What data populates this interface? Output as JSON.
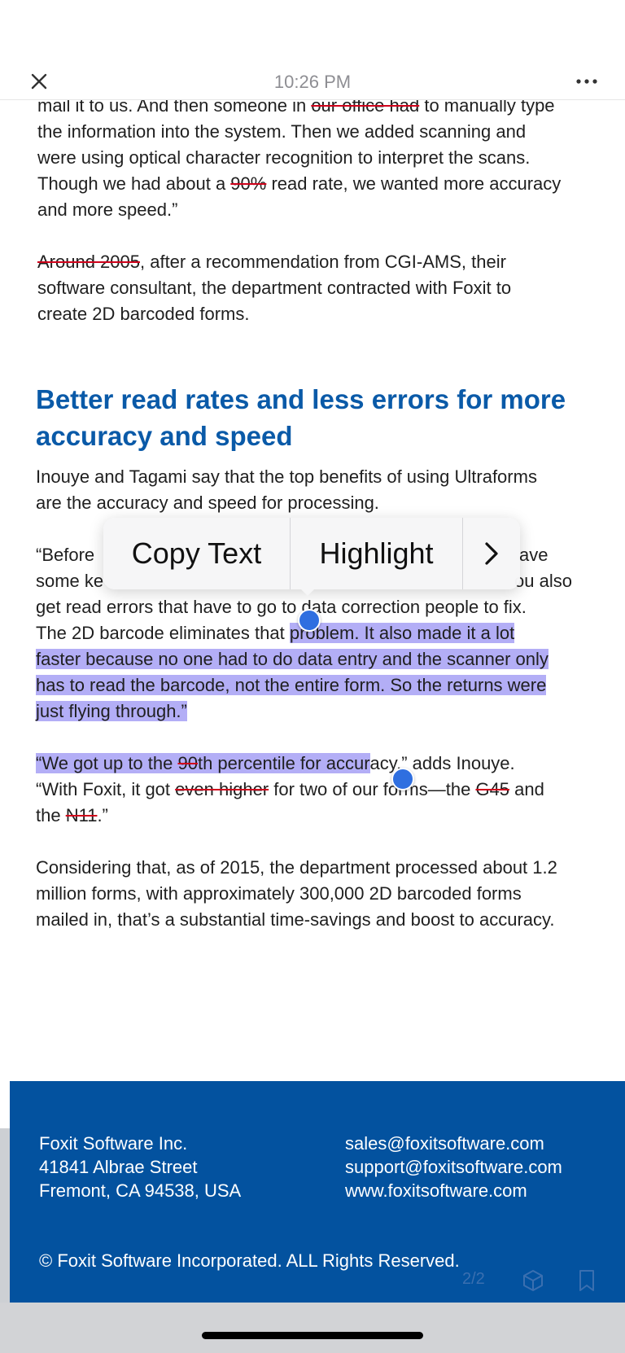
{
  "status": {
    "time": "10:26 PM"
  },
  "colors": {
    "heading": "#0a5aa8",
    "highlight": "#b3aef6",
    "footer_bg": "#03529f",
    "strike": "#d0021b",
    "handle": "#2f6fe0"
  },
  "toolbar": {
    "close_icon": "close-icon",
    "more_icon": "more-icon"
  },
  "para1": {
    "l1a": "mail it to us. And then someone in ",
    "l1s": "our office had",
    "l1b": " to manually type",
    "l2": "the information into the system. Then we added scanning and",
    "l3": "were using optical character recognition to interpret the scans.",
    "l4a": "Though we had about a ",
    "l4s": "90%",
    "l4b": " read rate, we wanted more accuracy",
    "l5": "and more speed.”"
  },
  "para2": {
    "l1s": "Around 2005",
    "l1b": ", after a recommendation from CGI-AMS, their",
    "l2": "software consultant, the department contracted with Foxit to",
    "l3": "create 2D barcoded forms."
  },
  "heading": {
    "l1": "Better read rates and less errors for more",
    "l2": "accuracy and speed"
  },
  "para3": {
    "l1": "Inouye and Tagami say that the top benefits of using Ultraforms",
    "l2": "are the accuracy and speed for processing."
  },
  "para4": {
    "l1a": "“Before",
    "l1b": "ave",
    "l2a": "some ke",
    "l2b": "ou also",
    "l3": "get read errors that have to go to data correction people to fix.",
    "l4a": "The 2D barcode eliminates that ",
    "l4h": "problem. It also made it a lot",
    "l5": "faster because no one had to do data entry and the scanner only",
    "l6": "has to read the barcode, not the entire form. So the returns were",
    "l7": "just flying through.”"
  },
  "para5": {
    "l1h1": "“We got up to the ",
    "l1s": "90",
    "l1h2": "th percentile for accur",
    "l1b": "acy,” adds Inouye.",
    "l2a": "“With Foxit, it got ",
    "l2s": "even higher",
    "l2b": " for two of our forms—the ",
    "l2s2": "G45",
    "l2c": " and",
    "l3a": "the ",
    "l3s": "N11",
    "l3b": ".”"
  },
  "para6": {
    "l1": "Considering that, as of 2015, the department processed about 1.2",
    "l2": "million forms, with approximately 300,000 2D barcoded forms",
    "l3": "mailed in, that’s a substantial time-savings and boost to accuracy."
  },
  "popup": {
    "copy": "Copy Text",
    "highlight": "Highlight",
    "next_icon": "chevron-right-icon"
  },
  "footer": {
    "company": "Foxit Software Inc.",
    "street": "41841 Albrae Street",
    "city": "Fremont, CA 94538, USA",
    "email_sales": "sales@foxitsoftware.com",
    "email_support": "support@foxitsoftware.com",
    "website": "www.foxitsoftware.com",
    "copyright": "© Foxit Software Incorporated. ALL Rights Reserved."
  },
  "pager": {
    "label": "2/2"
  },
  "bottom_icons": [
    "cube-icon",
    "bookmark-icon"
  ]
}
